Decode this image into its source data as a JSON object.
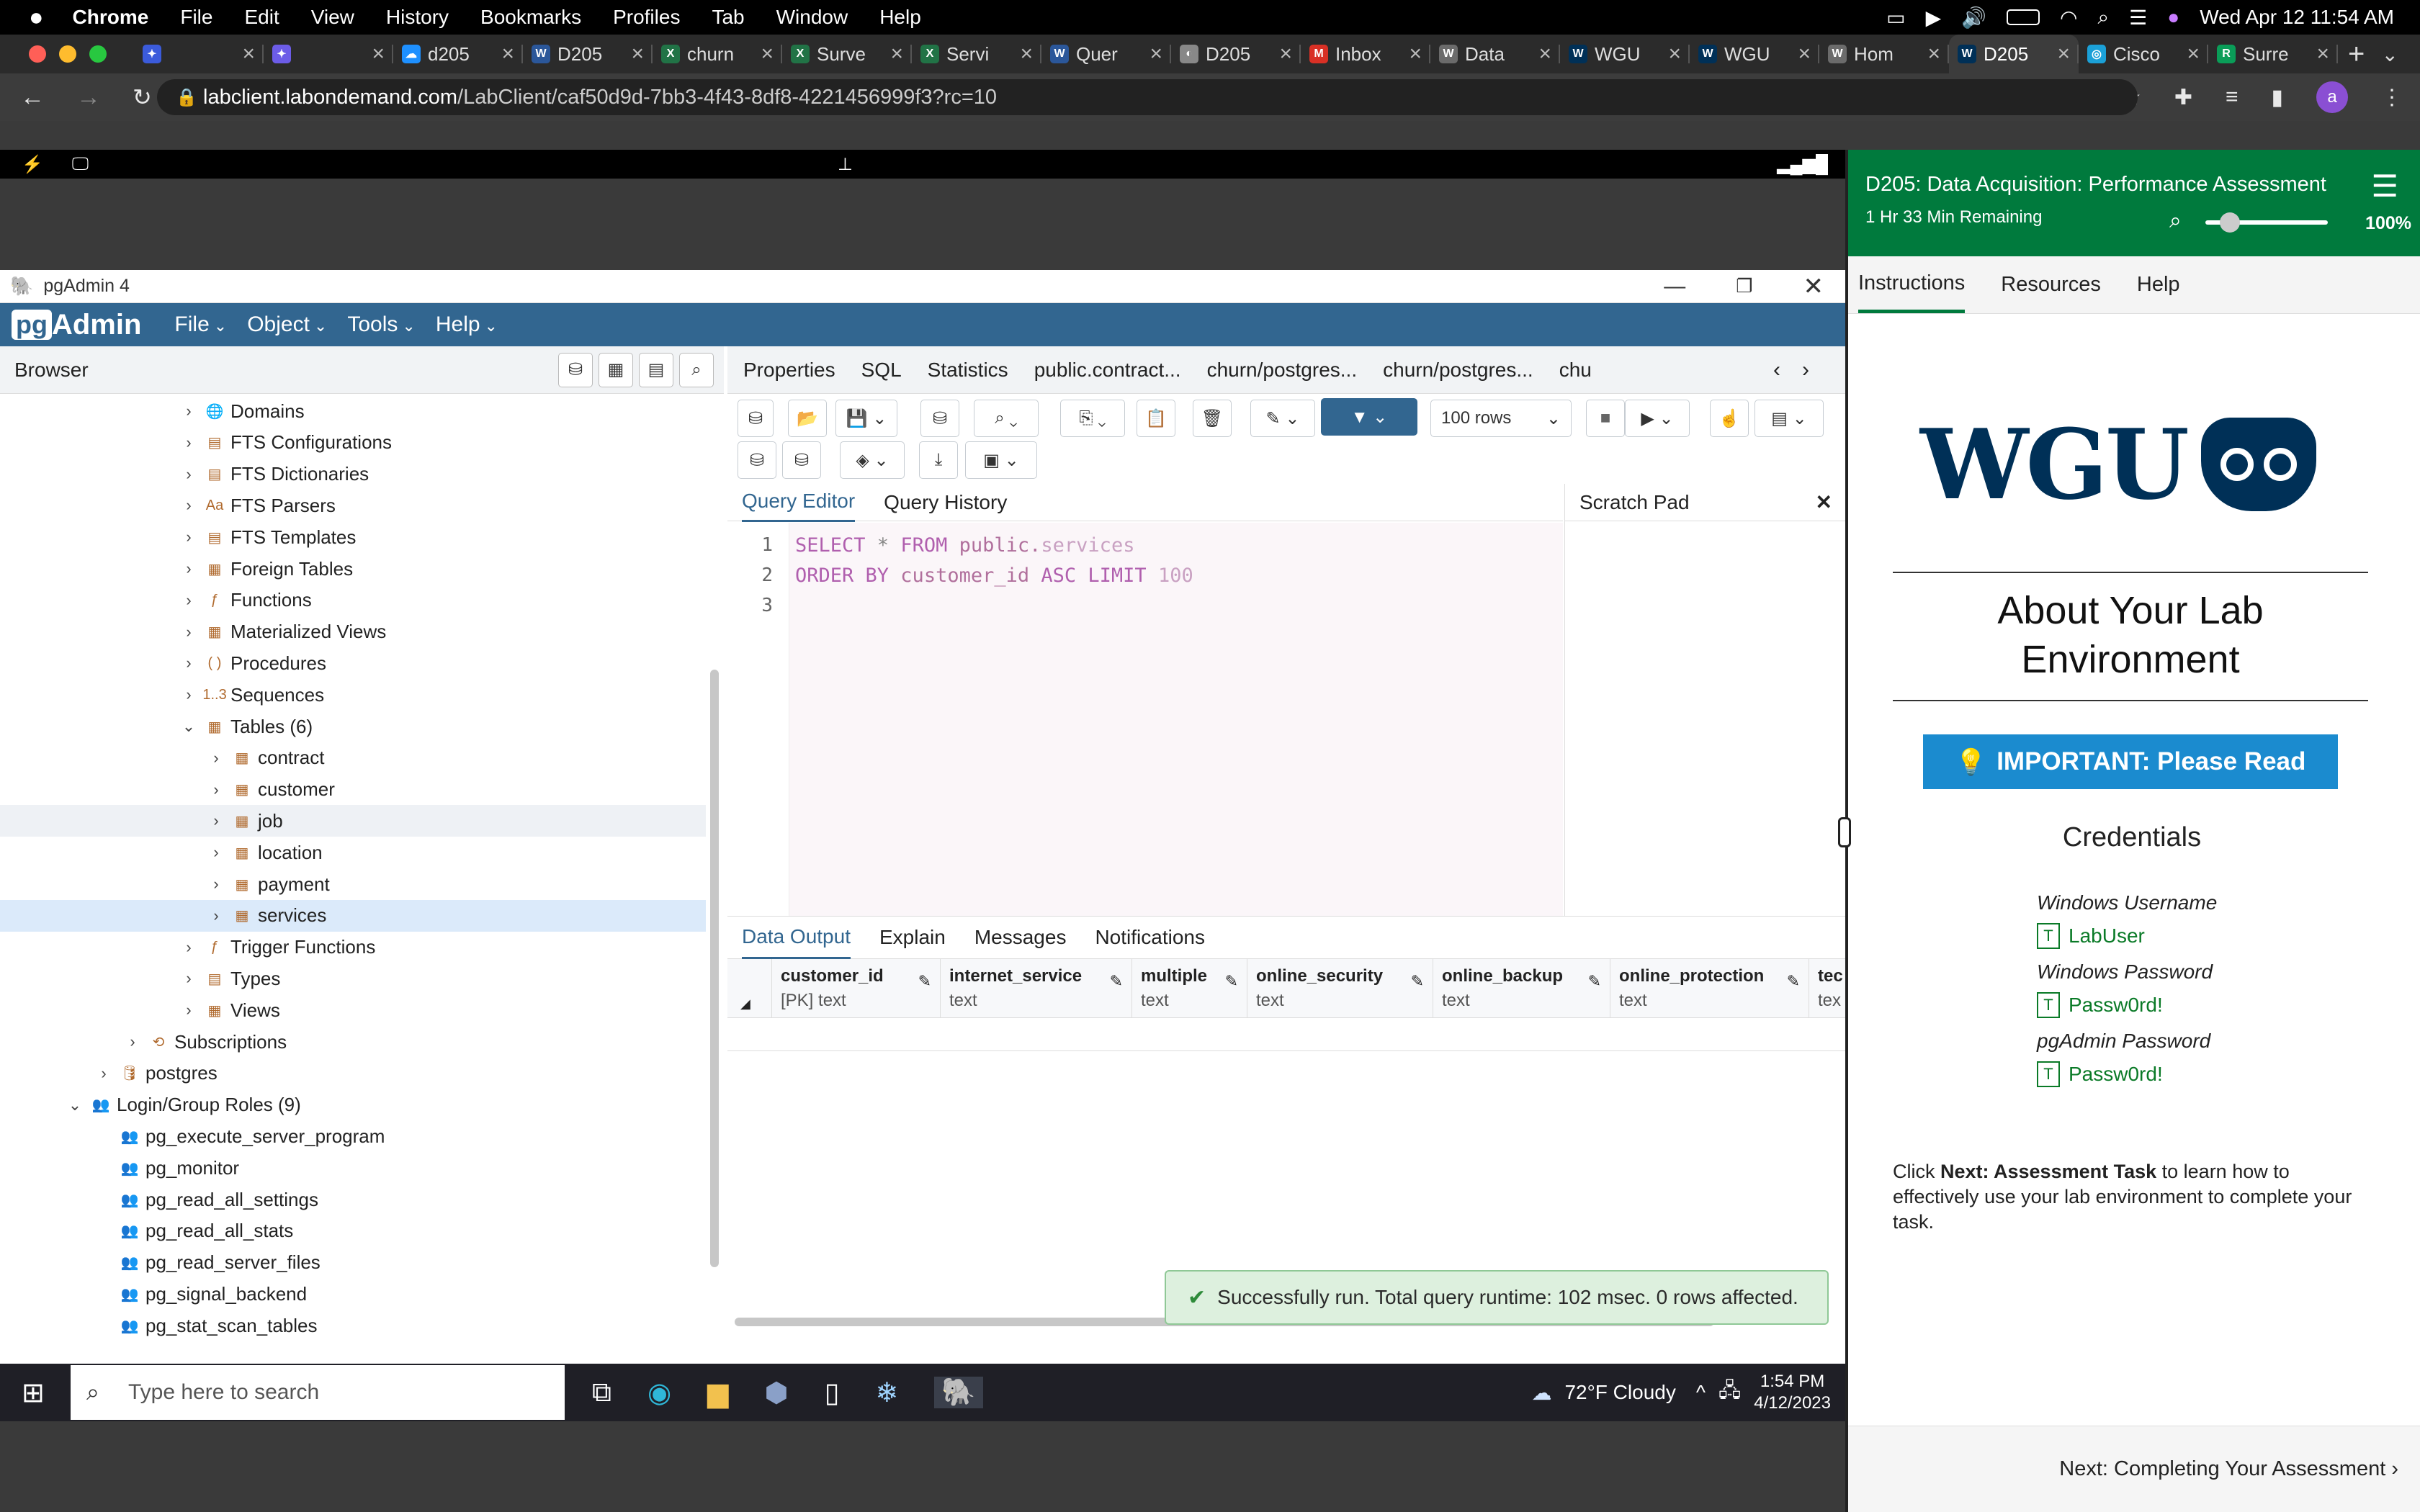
{
  "mac": {
    "app": "Chrome",
    "menus": [
      "File",
      "Edit",
      "View",
      "History",
      "Bookmarks",
      "Profiles",
      "Tab",
      "Window",
      "Help"
    ],
    "clock": "Wed Apr 12  11:54 AM"
  },
  "chrome": {
    "tabs": [
      {
        "title": "",
        "color": "#3b5bdb",
        "glyph": "✦"
      },
      {
        "title": "",
        "color": "#6c5ce7",
        "glyph": "✦"
      },
      {
        "title": "d205",
        "color": "#1e90ff",
        "glyph": "☁"
      },
      {
        "title": "D205",
        "color": "#2b579a",
        "glyph": "W"
      },
      {
        "title": "churn",
        "color": "#217346",
        "glyph": "X"
      },
      {
        "title": "Surve",
        "color": "#217346",
        "glyph": "X"
      },
      {
        "title": "Servi",
        "color": "#217346",
        "glyph": "X"
      },
      {
        "title": "Quer",
        "color": "#2b579a",
        "glyph": "W"
      },
      {
        "title": "D205",
        "color": "#888",
        "glyph": "◐"
      },
      {
        "title": "Inbox",
        "color": "#d93025",
        "glyph": "M"
      },
      {
        "title": "Data",
        "color": "#6b6b6b",
        "glyph": "W"
      },
      {
        "title": "WGU",
        "color": "#003057",
        "glyph": "W"
      },
      {
        "title": "WGU",
        "color": "#003057",
        "glyph": "W"
      },
      {
        "title": "Hom",
        "color": "#6b6b6b",
        "glyph": "W"
      },
      {
        "title": "D205",
        "color": "#003057",
        "glyph": "W"
      },
      {
        "title": "Cisco",
        "color": "#1ba0d7",
        "glyph": "◎"
      },
      {
        "title": "Surre",
        "color": "#0a9d58",
        "glyph": "R"
      }
    ],
    "active_tab": 14,
    "url_host": "labclient.labondemand.com",
    "url_path": "/LabClient/caf50d9d-7bb3-4f43-8df8-4221456999f3?rc=10",
    "avatar": "a"
  },
  "pgadmin": {
    "window_title": "pgAdmin 4",
    "logo_pg": "pg",
    "logo_text": "Admin",
    "menus": [
      "File",
      "Object",
      "Tools",
      "Help"
    ],
    "browser_title": "Browser",
    "tree": [
      {
        "label": "Domains",
        "indent": 1,
        "icon": "🌐",
        "caret": "›"
      },
      {
        "label": "FTS Configurations",
        "indent": 1,
        "icon": "▤",
        "caret": "›"
      },
      {
        "label": "FTS Dictionaries",
        "indent": 1,
        "icon": "▤",
        "caret": "›"
      },
      {
        "label": "FTS Parsers",
        "indent": 1,
        "icon": "Aa",
        "caret": "›"
      },
      {
        "label": "FTS Templates",
        "indent": 1,
        "icon": "▤",
        "caret": "›"
      },
      {
        "label": "Foreign Tables",
        "indent": 1,
        "icon": "▦",
        "caret": "›"
      },
      {
        "label": "Functions",
        "indent": 1,
        "icon": "ƒ",
        "caret": "›"
      },
      {
        "label": "Materialized Views",
        "indent": 1,
        "icon": "▦",
        "caret": "›"
      },
      {
        "label": "Procedures",
        "indent": 1,
        "icon": "( )",
        "caret": "›"
      },
      {
        "label": "Sequences",
        "indent": 1,
        "icon": "1..3",
        "caret": "›"
      },
      {
        "label": "Tables (6)",
        "indent": 1,
        "icon": "▦",
        "caret": "⌄"
      },
      {
        "label": "contract",
        "indent": 2,
        "icon": "▦",
        "caret": "›"
      },
      {
        "label": "customer",
        "indent": 2,
        "icon": "▦",
        "caret": "›"
      },
      {
        "label": "job",
        "indent": 2,
        "icon": "▦",
        "caret": "›",
        "state": "hov"
      },
      {
        "label": "location",
        "indent": 2,
        "icon": "▦",
        "caret": "›"
      },
      {
        "label": "payment",
        "indent": 2,
        "icon": "▦",
        "caret": "›"
      },
      {
        "label": "services",
        "indent": 2,
        "icon": "▦",
        "caret": "›",
        "state": "sel"
      },
      {
        "label": "Trigger Functions",
        "indent": 1,
        "icon": "ƒ",
        "caret": "›"
      },
      {
        "label": "Types",
        "indent": 1,
        "icon": "▤",
        "caret": "›"
      },
      {
        "label": "Views",
        "indent": 1,
        "icon": "▦",
        "caret": "›"
      },
      {
        "label": "Subscriptions",
        "indent": 0,
        "icon": "⟲",
        "caret": "›"
      },
      {
        "label": "postgres",
        "indent": -1,
        "icon": "🛢",
        "caret": "›"
      },
      {
        "label": "Login/Group Roles (9)",
        "indent": -2,
        "icon": "👥",
        "caret": "⌄"
      },
      {
        "label": "pg_execute_server_program",
        "indent": -1,
        "icon": "👥",
        "caret": ""
      },
      {
        "label": "pg_monitor",
        "indent": -1,
        "icon": "👥",
        "caret": ""
      },
      {
        "label": "pg_read_all_settings",
        "indent": -1,
        "icon": "👥",
        "caret": ""
      },
      {
        "label": "pg_read_all_stats",
        "indent": -1,
        "icon": "👥",
        "caret": ""
      },
      {
        "label": "pg_read_server_files",
        "indent": -1,
        "icon": "👥",
        "caret": ""
      },
      {
        "label": "pg_signal_backend",
        "indent": -1,
        "icon": "👥",
        "caret": ""
      },
      {
        "label": "pg_stat_scan_tables",
        "indent": -1,
        "icon": "👥",
        "caret": ""
      }
    ],
    "object_tabs": [
      "Properties",
      "SQL",
      "Statistics",
      "public.contract...",
      "churn/postgres...",
      "churn/postgres...",
      "chu"
    ],
    "rows_select": "100 rows",
    "editor_tabs": {
      "query_editor": "Query Editor",
      "query_history": "Query History",
      "scratch_pad": "Scratch Pad"
    },
    "sql_lines": [
      [
        {
          "t": "SELECT",
          "c": "kw"
        },
        {
          "t": " * ",
          "c": "op"
        },
        {
          "t": "FROM",
          "c": "kw"
        },
        {
          "t": " public.",
          "c": "id"
        },
        {
          "t": "services",
          "c": "fn"
        }
      ],
      [
        {
          "t": "ORDER BY",
          "c": "kw"
        },
        {
          "t": " customer_id ",
          "c": "id"
        },
        {
          "t": "ASC LIMIT",
          "c": "kw"
        },
        {
          "t": " 100",
          "c": "num"
        }
      ],
      []
    ],
    "line_numbers": [
      "1",
      "2",
      "3"
    ],
    "output_tabs": [
      "Data Output",
      "Explain",
      "Messages",
      "Notifications"
    ],
    "columns": [
      {
        "name": "customer_id",
        "type": "[PK] text"
      },
      {
        "name": "internet_service",
        "type": "text"
      },
      {
        "name": "multiple",
        "type": "text"
      },
      {
        "name": "online_security",
        "type": "text"
      },
      {
        "name": "online_backup",
        "type": "text"
      },
      {
        "name": "online_protection",
        "type": "text"
      },
      {
        "name": "tec",
        "type": "tex"
      }
    ],
    "toast": "Successfully run. Total query runtime: 102 msec. 0 rows affected."
  },
  "taskbar": {
    "search_placeholder": "Type here to search",
    "weather": "72°F  Cloudy",
    "time": "1:54 PM",
    "date": "4/12/2023"
  },
  "wgu": {
    "course_title": "D205: Data Acquisition: Performance Assessment",
    "time_remaining": "1 Hr 33 Min Remaining",
    "zoom": "100%",
    "zoom_fraction": 0.2,
    "tabs": [
      "Instructions",
      "Resources",
      "Help"
    ],
    "logo": "WGU",
    "heading": "About Your Lab Environment",
    "important_btn": "IMPORTANT: Please Read",
    "credentials_heading": "Credentials",
    "creds": [
      {
        "label": "Windows Username",
        "value": "LabUser"
      },
      {
        "label": "Windows Password",
        "value": "Passw0rd!"
      },
      {
        "label": "pgAdmin Password",
        "value": "Passw0rd!"
      }
    ],
    "body_pre": "Click ",
    "body_bold": "Next: Assessment Task",
    "body_post": " to learn how to effectively use your lab environment to complete your task.",
    "next_link": "Next: Completing Your Assessment"
  },
  "colors": {
    "pg_blue": "#326690",
    "wgu_green": "#007a3d",
    "wgu_navy": "#003057",
    "chrome_dark": "#2b2b2b"
  }
}
